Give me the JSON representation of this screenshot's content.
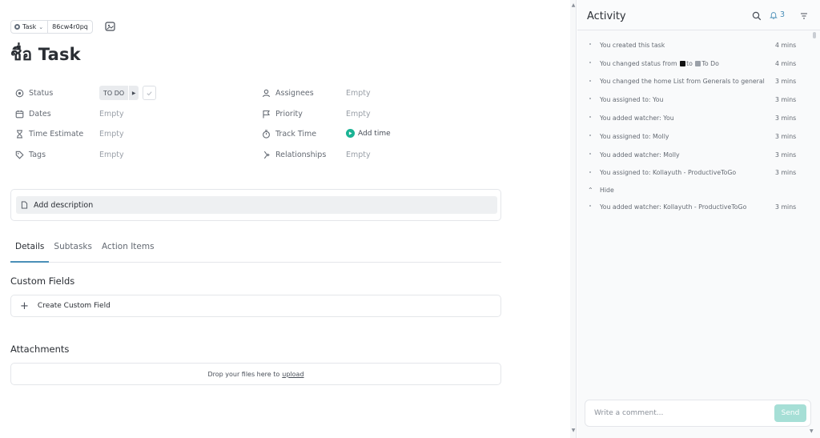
{
  "breadcrumb": {
    "type_label": "Task",
    "task_id": "86cw4r0pq"
  },
  "task": {
    "title": "ชื่อ Task"
  },
  "fields": {
    "status": {
      "label": "Status",
      "value": "TO DO"
    },
    "dates": {
      "label": "Dates",
      "value": "Empty"
    },
    "time_estimate": {
      "label": "Time Estimate",
      "value": "Empty"
    },
    "tags": {
      "label": "Tags",
      "value": "Empty"
    },
    "assignees": {
      "label": "Assignees",
      "value": "Empty"
    },
    "priority": {
      "label": "Priority",
      "value": "Empty"
    },
    "track_time": {
      "label": "Track Time",
      "value": "Add time"
    },
    "relationships": {
      "label": "Relationships",
      "value": "Empty"
    }
  },
  "description": {
    "placeholder": "Add description"
  },
  "tabs": [
    "Details",
    "Subtasks",
    "Action Items"
  ],
  "custom_fields": {
    "title": "Custom Fields",
    "create_label": "Create Custom Field"
  },
  "attachments": {
    "title": "Attachments",
    "drop_text": "Drop your files here to",
    "upload_link": "upload"
  },
  "activity": {
    "title": "Activity",
    "notification_count": "3",
    "items": [
      {
        "text": "You created this task",
        "time": "4 mins"
      },
      {
        "text_before": "You changed status from",
        "to": "to",
        "status_after": "To Do",
        "time": "4 mins"
      },
      {
        "text": "You changed the home List from Generals to general",
        "time": "3 mins"
      },
      {
        "text": "You assigned to: You",
        "time": "3 mins"
      },
      {
        "text": "You added watcher: You",
        "time": "3 mins"
      },
      {
        "text": "You assigned to: Molly",
        "time": "3 mins"
      },
      {
        "text": "You added watcher: Molly",
        "time": "3 mins"
      },
      {
        "text": "You assigned to: Kollayuth - ProductiveToGo",
        "time": "3 mins"
      }
    ],
    "hide_label": "Hide",
    "extra_item": {
      "text": "You added watcher: Kollayuth - ProductiveToGo",
      "time": "3 mins"
    },
    "comment_placeholder": "Write a comment...",
    "send_label": "Send"
  },
  "colors": {
    "accent": "#4a8fb8",
    "track_time_green": "#1ab394",
    "send_button": "#a6dfd6",
    "status_from_square": "#111111",
    "status_to_square": "#9aa0a8"
  },
  "icons": [
    "status-icon",
    "calendar-icon",
    "hourglass-icon",
    "tag-icon",
    "user-icon",
    "flag-icon",
    "stopwatch-icon",
    "relationship-icon",
    "image-icon",
    "document-icon",
    "search-icon",
    "bell-icon",
    "filter-icon",
    "play-icon",
    "check-icon"
  ]
}
